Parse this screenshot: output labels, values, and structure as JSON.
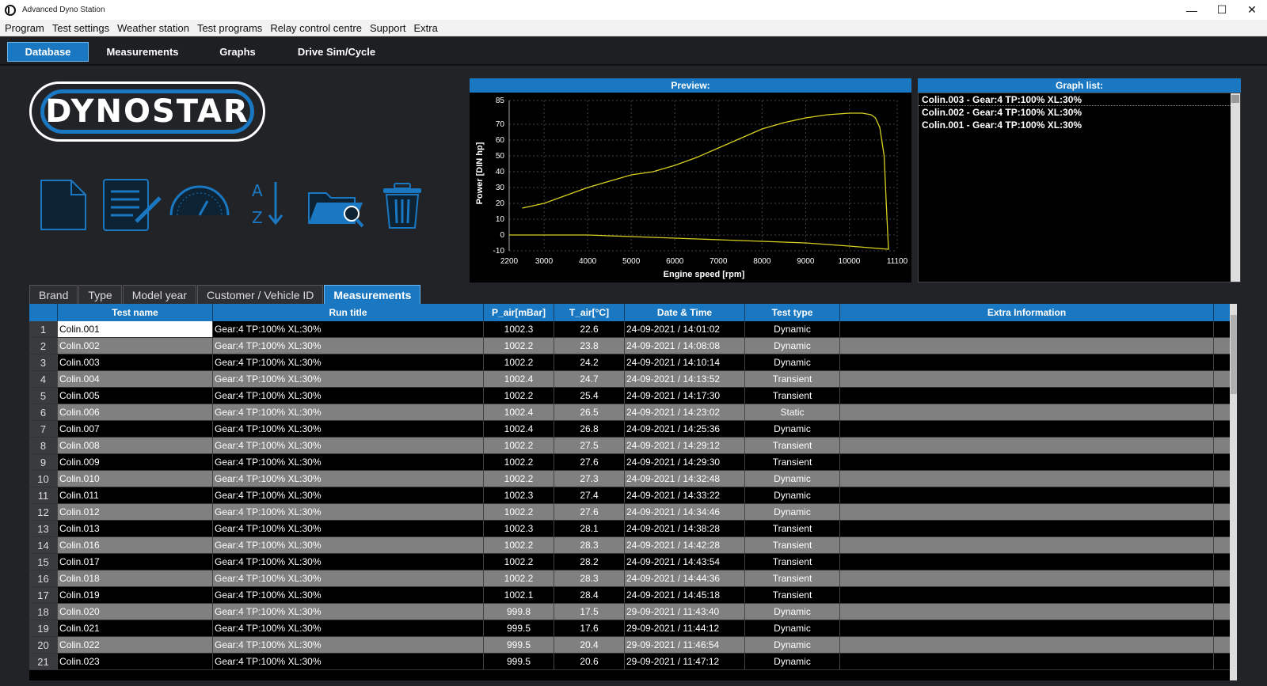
{
  "window": {
    "title": "Advanced Dyno Station",
    "minimize": "—",
    "maximize": "☐",
    "close": "✕"
  },
  "menu": [
    "Program",
    "Test settings",
    "Weather station",
    "Test programs",
    "Relay control centre",
    "Support",
    "Extra"
  ],
  "main_tabs": [
    {
      "label": "Database",
      "active": true
    },
    {
      "label": "Measurements"
    },
    {
      "label": "Graphs"
    },
    {
      "label": "Drive Sim/Cycle"
    }
  ],
  "logo_text": "DYNOSTAR",
  "toolbar_icons": [
    "new-file-icon",
    "edit-document-icon",
    "gauge-icon",
    "sort-az-icon",
    "folder-search-icon",
    "trash-icon"
  ],
  "preview": {
    "title": "Preview:"
  },
  "graph_list": {
    "title": "Graph list:",
    "items": [
      "Colin.003 - Gear:4 TP:100% XL:30%",
      "Colin.002 - Gear:4 TP:100% XL:30%",
      "Colin.001 - Gear:4 TP:100% XL:30%"
    ]
  },
  "chart_data": {
    "type": "line",
    "xlabel": "Engine speed [rpm]",
    "ylabel": "Power [DIN hp]",
    "x_ticks": [
      2200,
      3000,
      4000,
      5000,
      6000,
      7000,
      8000,
      9000,
      10000,
      11100
    ],
    "y_ticks": [
      -10,
      0,
      10,
      20,
      30,
      40,
      50,
      60,
      70,
      85
    ],
    "xlim": [
      2200,
      11100
    ],
    "ylim": [
      -10,
      85
    ],
    "grid": true,
    "color": "#d8d020",
    "series": [
      {
        "x": [
          2500,
          3000,
          3500,
          4000,
          4500,
          5000,
          5500,
          6000,
          6500,
          7000,
          7500,
          8000,
          8500,
          9000,
          9500,
          10000,
          10300,
          10500,
          10600,
          10700,
          10800,
          10850,
          10900,
          10900,
          10000,
          9000,
          8000,
          7000,
          6000,
          5000,
          4000,
          3000,
          2200
        ],
        "y": [
          17,
          20,
          25,
          30,
          34,
          38,
          40,
          44,
          49,
          55,
          61,
          67,
          71,
          74,
          76,
          77,
          77,
          76,
          74,
          68,
          50,
          20,
          -9,
          -9,
          -7,
          -5,
          -4,
          -3,
          -2,
          -1,
          0,
          0,
          0
        ]
      }
    ]
  },
  "sub_tabs": [
    {
      "label": "Brand"
    },
    {
      "label": "Type"
    },
    {
      "label": "Model year"
    },
    {
      "label": "Customer / Vehicle ID"
    },
    {
      "label": "Measurements",
      "active": true
    }
  ],
  "table": {
    "headers": [
      "Test name",
      "Run title",
      "P_air[mBar]",
      "T_air[°C]",
      "Date & Time",
      "Test type",
      "Extra Information"
    ],
    "rows": [
      [
        "1",
        "Colin.001",
        "Gear:4 TP:100% XL:30%",
        "1002.3",
        "22.6",
        "24-09-2021 / 14:01:02",
        "Dynamic",
        ""
      ],
      [
        "2",
        "Colin.002",
        "Gear:4 TP:100% XL:30%",
        "1002.2",
        "23.8",
        "24-09-2021 / 14:08:08",
        "Dynamic",
        ""
      ],
      [
        "3",
        "Colin.003",
        "Gear:4 TP:100% XL:30%",
        "1002.2",
        "24.2",
        "24-09-2021 / 14:10:14",
        "Dynamic",
        ""
      ],
      [
        "4",
        "Colin.004",
        "Gear:4 TP:100% XL:30%",
        "1002.4",
        "24.7",
        "24-09-2021 / 14:13:52",
        "Transient",
        ""
      ],
      [
        "5",
        "Colin.005",
        "Gear:4 TP:100% XL:30%",
        "1002.2",
        "25.4",
        "24-09-2021 / 14:17:30",
        "Transient",
        ""
      ],
      [
        "6",
        "Colin.006",
        "Gear:4 TP:100% XL:30%",
        "1002.4",
        "26.5",
        "24-09-2021 / 14:23:02",
        "Static",
        ""
      ],
      [
        "7",
        "Colin.007",
        "Gear:4 TP:100% XL:30%",
        "1002.4",
        "26.8",
        "24-09-2021 / 14:25:36",
        "Dynamic",
        ""
      ],
      [
        "8",
        "Colin.008",
        "Gear:4 TP:100% XL:30%",
        "1002.2",
        "27.5",
        "24-09-2021 / 14:29:12",
        "Transient",
        ""
      ],
      [
        "9",
        "Colin.009",
        "Gear:4 TP:100% XL:30%",
        "1002.2",
        "27.6",
        "24-09-2021 / 14:29:30",
        "Transient",
        ""
      ],
      [
        "10",
        "Colin.010",
        "Gear:4 TP:100% XL:30%",
        "1002.2",
        "27.3",
        "24-09-2021 / 14:32:48",
        "Dynamic",
        ""
      ],
      [
        "11",
        "Colin.011",
        "Gear:4 TP:100% XL:30%",
        "1002.3",
        "27.4",
        "24-09-2021 / 14:33:22",
        "Dynamic",
        ""
      ],
      [
        "12",
        "Colin.012",
        "Gear:4 TP:100% XL:30%",
        "1002.2",
        "27.6",
        "24-09-2021 / 14:34:46",
        "Dynamic",
        ""
      ],
      [
        "13",
        "Colin.013",
        "Gear:4 TP:100% XL:30%",
        "1002.3",
        "28.1",
        "24-09-2021 / 14:38:28",
        "Transient",
        ""
      ],
      [
        "14",
        "Colin.016",
        "Gear:4 TP:100% XL:30%",
        "1002.2",
        "28.3",
        "24-09-2021 / 14:42:28",
        "Transient",
        ""
      ],
      [
        "15",
        "Colin.017",
        "Gear:4 TP:100% XL:30%",
        "1002.2",
        "28.2",
        "24-09-2021 / 14:43:54",
        "Transient",
        ""
      ],
      [
        "16",
        "Colin.018",
        "Gear:4 TP:100% XL:30%",
        "1002.2",
        "28.3",
        "24-09-2021 / 14:44:36",
        "Transient",
        ""
      ],
      [
        "17",
        "Colin.019",
        "Gear:4 TP:100% XL:30%",
        "1002.1",
        "28.4",
        "24-09-2021 / 14:45:18",
        "Transient",
        ""
      ],
      [
        "18",
        "Colin.020",
        "Gear:4 TP:100% XL:30%",
        "999.8",
        "17.5",
        "29-09-2021 / 11:43:40",
        "Dynamic",
        ""
      ],
      [
        "19",
        "Colin.021",
        "Gear:4 TP:100% XL:30%",
        "999.5",
        "17.6",
        "29-09-2021 / 11:44:12",
        "Dynamic",
        ""
      ],
      [
        "20",
        "Colin.022",
        "Gear:4 TP:100% XL:30%",
        "999.5",
        "20.4",
        "29-09-2021 / 11:46:54",
        "Dynamic",
        ""
      ],
      [
        "21",
        "Colin.023",
        "Gear:4 TP:100% XL:30%",
        "999.5",
        "20.6",
        "29-09-2021 / 11:47:12",
        "Dynamic",
        ""
      ]
    ]
  }
}
